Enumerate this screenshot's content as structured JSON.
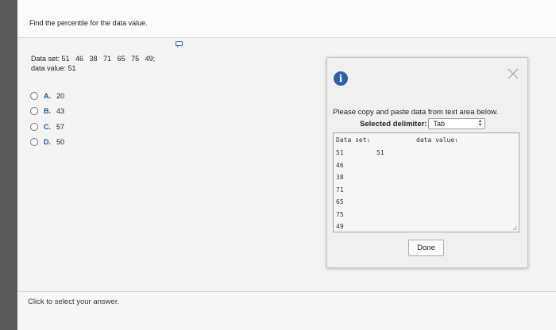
{
  "question": {
    "prompt": "Find the percentile for the data value.",
    "data_set_line": "Data set: 51   46   38   71   65   75   49;",
    "data_value_line": "data value: 51"
  },
  "options": [
    {
      "letter": "A.",
      "value": "20"
    },
    {
      "letter": "B.",
      "value": "43"
    },
    {
      "letter": "C.",
      "value": "57"
    },
    {
      "letter": "D.",
      "value": "50"
    }
  ],
  "footer": {
    "hint": "Click to select your answer."
  },
  "dialog": {
    "info_glyph": "i",
    "instruction": "Please copy and paste data from text area below.",
    "delimiter_label": "Selected delimiter:",
    "delimiter_value": "Tab",
    "textarea": {
      "header_left": "Data set:",
      "header_right": "data value:",
      "data_set_values": [
        "51",
        "46",
        "38",
        "71",
        "65",
        "75",
        "49"
      ],
      "data_value": "51"
    },
    "done_label": "Done"
  },
  "colors": {
    "accent": "#2f5fa8",
    "option_letter": "#1f4f8a"
  }
}
